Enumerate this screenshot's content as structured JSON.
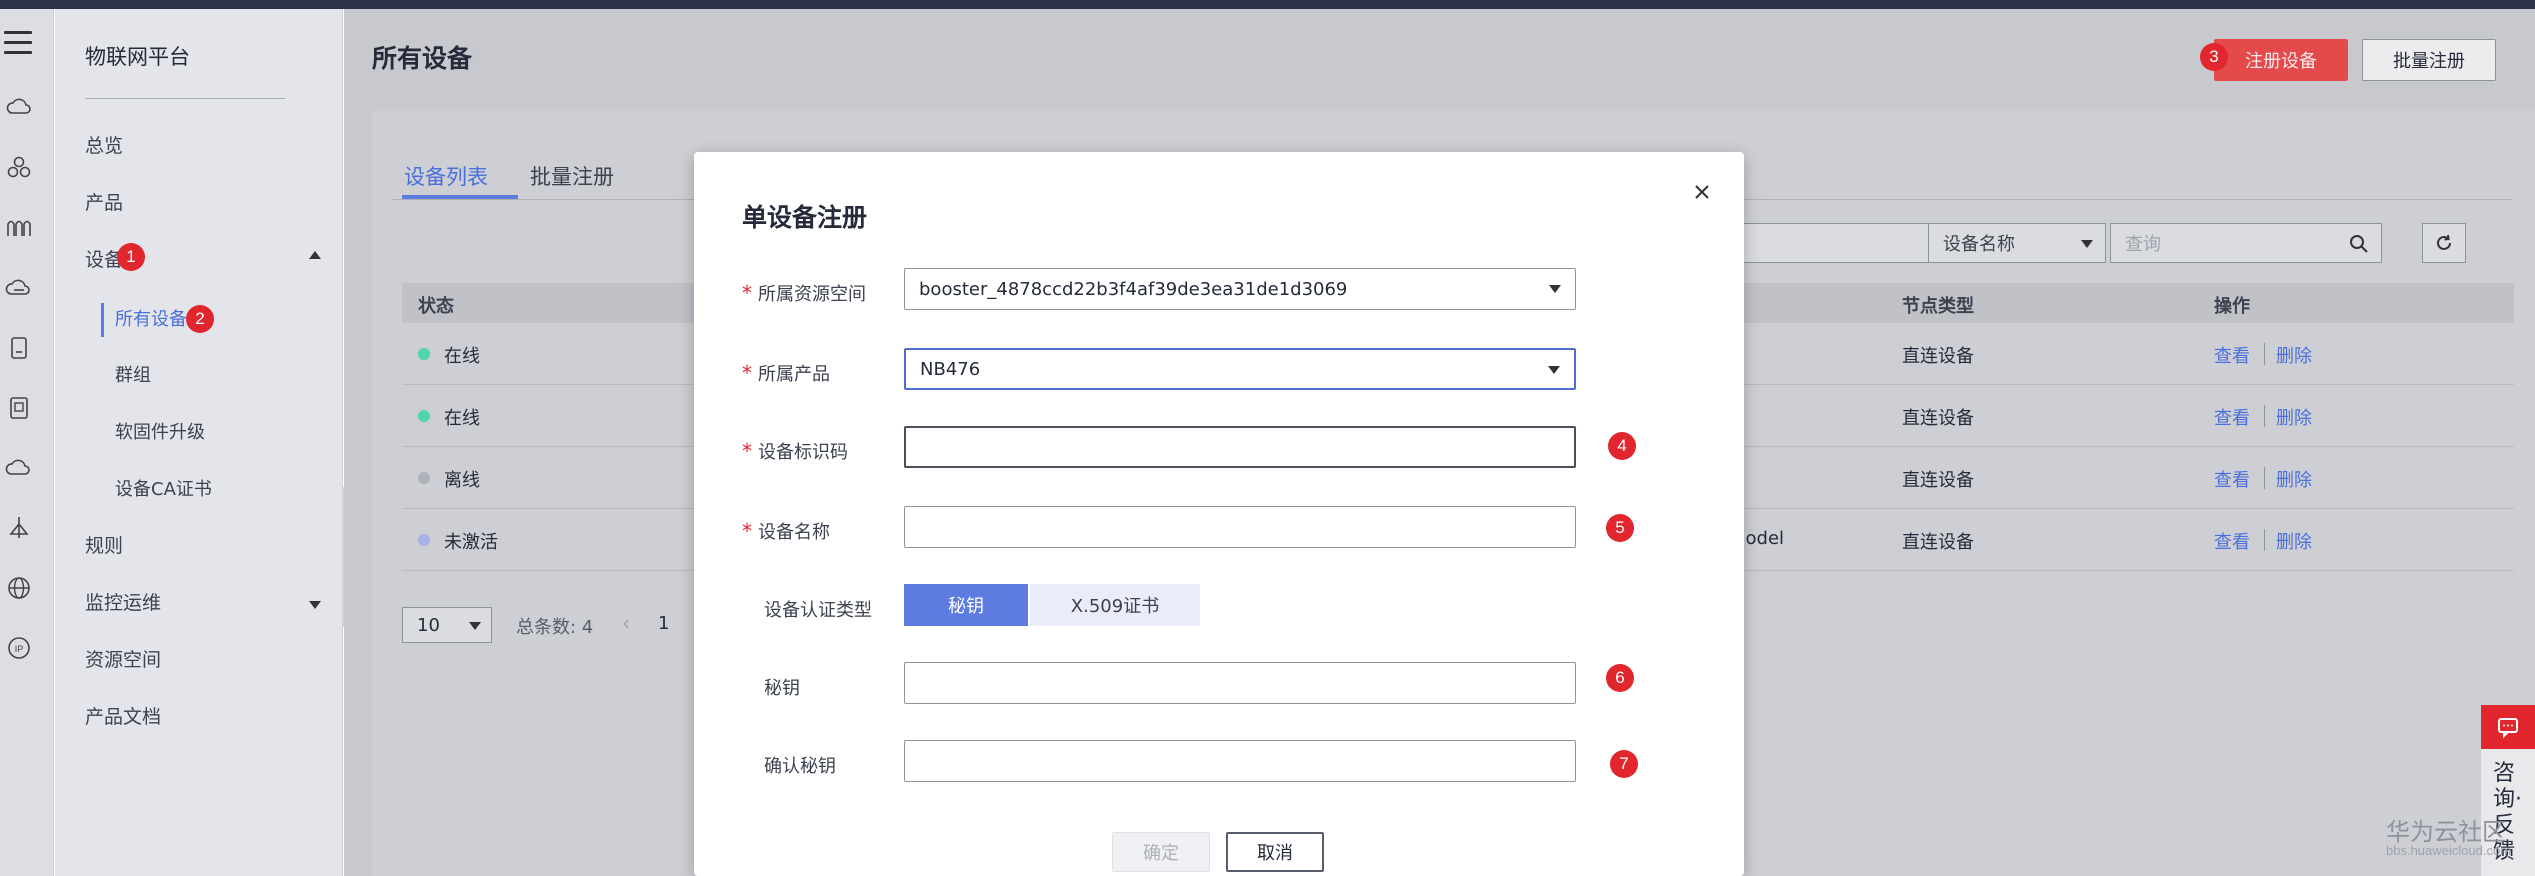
{
  "platform": {
    "title": "物联网平台"
  },
  "rail_icons": [
    "menu-icon",
    "cloud-icon",
    "cluster-icon",
    "waves-icon",
    "cloud-chat-icon",
    "device-box-icon",
    "device-card-icon",
    "cloud-outline-icon",
    "antenna-icon",
    "globe-icon",
    "ip-icon"
  ],
  "nav": {
    "overview": "总览",
    "product": "产品",
    "device": "设备",
    "all_devices": "所有设备",
    "group": "群组",
    "firmware": "软固件升级",
    "ca_cert": "设备CA证书",
    "rules": "规则",
    "monitor": "监控运维",
    "resource_space": "资源空间",
    "docs": "产品文档"
  },
  "markers": {
    "m1": "1",
    "m2": "2",
    "m3": "3",
    "m4": "4",
    "m5": "5",
    "m6": "6",
    "m7": "7"
  },
  "header": {
    "title": "所有设备",
    "register_button": "注册设备",
    "batch_button": "批量注册"
  },
  "tabs": {
    "device_list": "设备列表",
    "batch_register": "批量注册"
  },
  "filters": {
    "field_select": "设备名称",
    "search_placeholder": "查询"
  },
  "table": {
    "columns": {
      "status": "状态",
      "node_type": "节点类型",
      "actions": "操作"
    },
    "rows": [
      {
        "status": "在线",
        "extra": "",
        "node_type": "直连设备",
        "view": "查看",
        "delete": "删除"
      },
      {
        "status": "在线",
        "extra": "",
        "node_type": "直连设备",
        "view": "查看",
        "delete": "删除"
      },
      {
        "status": "离线",
        "extra": "",
        "node_type": "直连设备",
        "view": "查看",
        "delete": "删除"
      },
      {
        "status": "未激活",
        "extra": "model",
        "node_type": "直连设备",
        "view": "查看",
        "delete": "删除"
      }
    ]
  },
  "pager": {
    "page_size": "10",
    "total": "总条数: 4",
    "prev": "‹",
    "page": "1"
  },
  "modal": {
    "title": "单设备注册",
    "resource_space_label": "所属资源空间",
    "resource_space_value": "booster_4878ccd22b3f4af39de3ea31de1d3069",
    "product_label": "所属产品",
    "product_value": "NB476",
    "device_id_label": "设备标识码",
    "device_id_value": "",
    "device_name_label": "设备名称",
    "device_name_value": "",
    "auth_type_label": "设备认证类型",
    "auth_secret": "秘钥",
    "auth_x509": "X.509证书",
    "secret_label": "秘钥",
    "secret_value": "",
    "confirm_secret_label": "确认秘钥",
    "confirm_secret_value": "",
    "ok_button": "确定",
    "cancel_button": "取消"
  },
  "widget": {
    "consult": "咨询·反馈"
  },
  "watermark": {
    "line1": "华为云社区",
    "line2": "bbs.huaweicloud.com"
  },
  "colors": {
    "accent": "#5e7ce0",
    "danger": "#e1262d",
    "online": "#50d4ab",
    "offline": "#adb0b8",
    "inactive": "#a6b2e8"
  }
}
